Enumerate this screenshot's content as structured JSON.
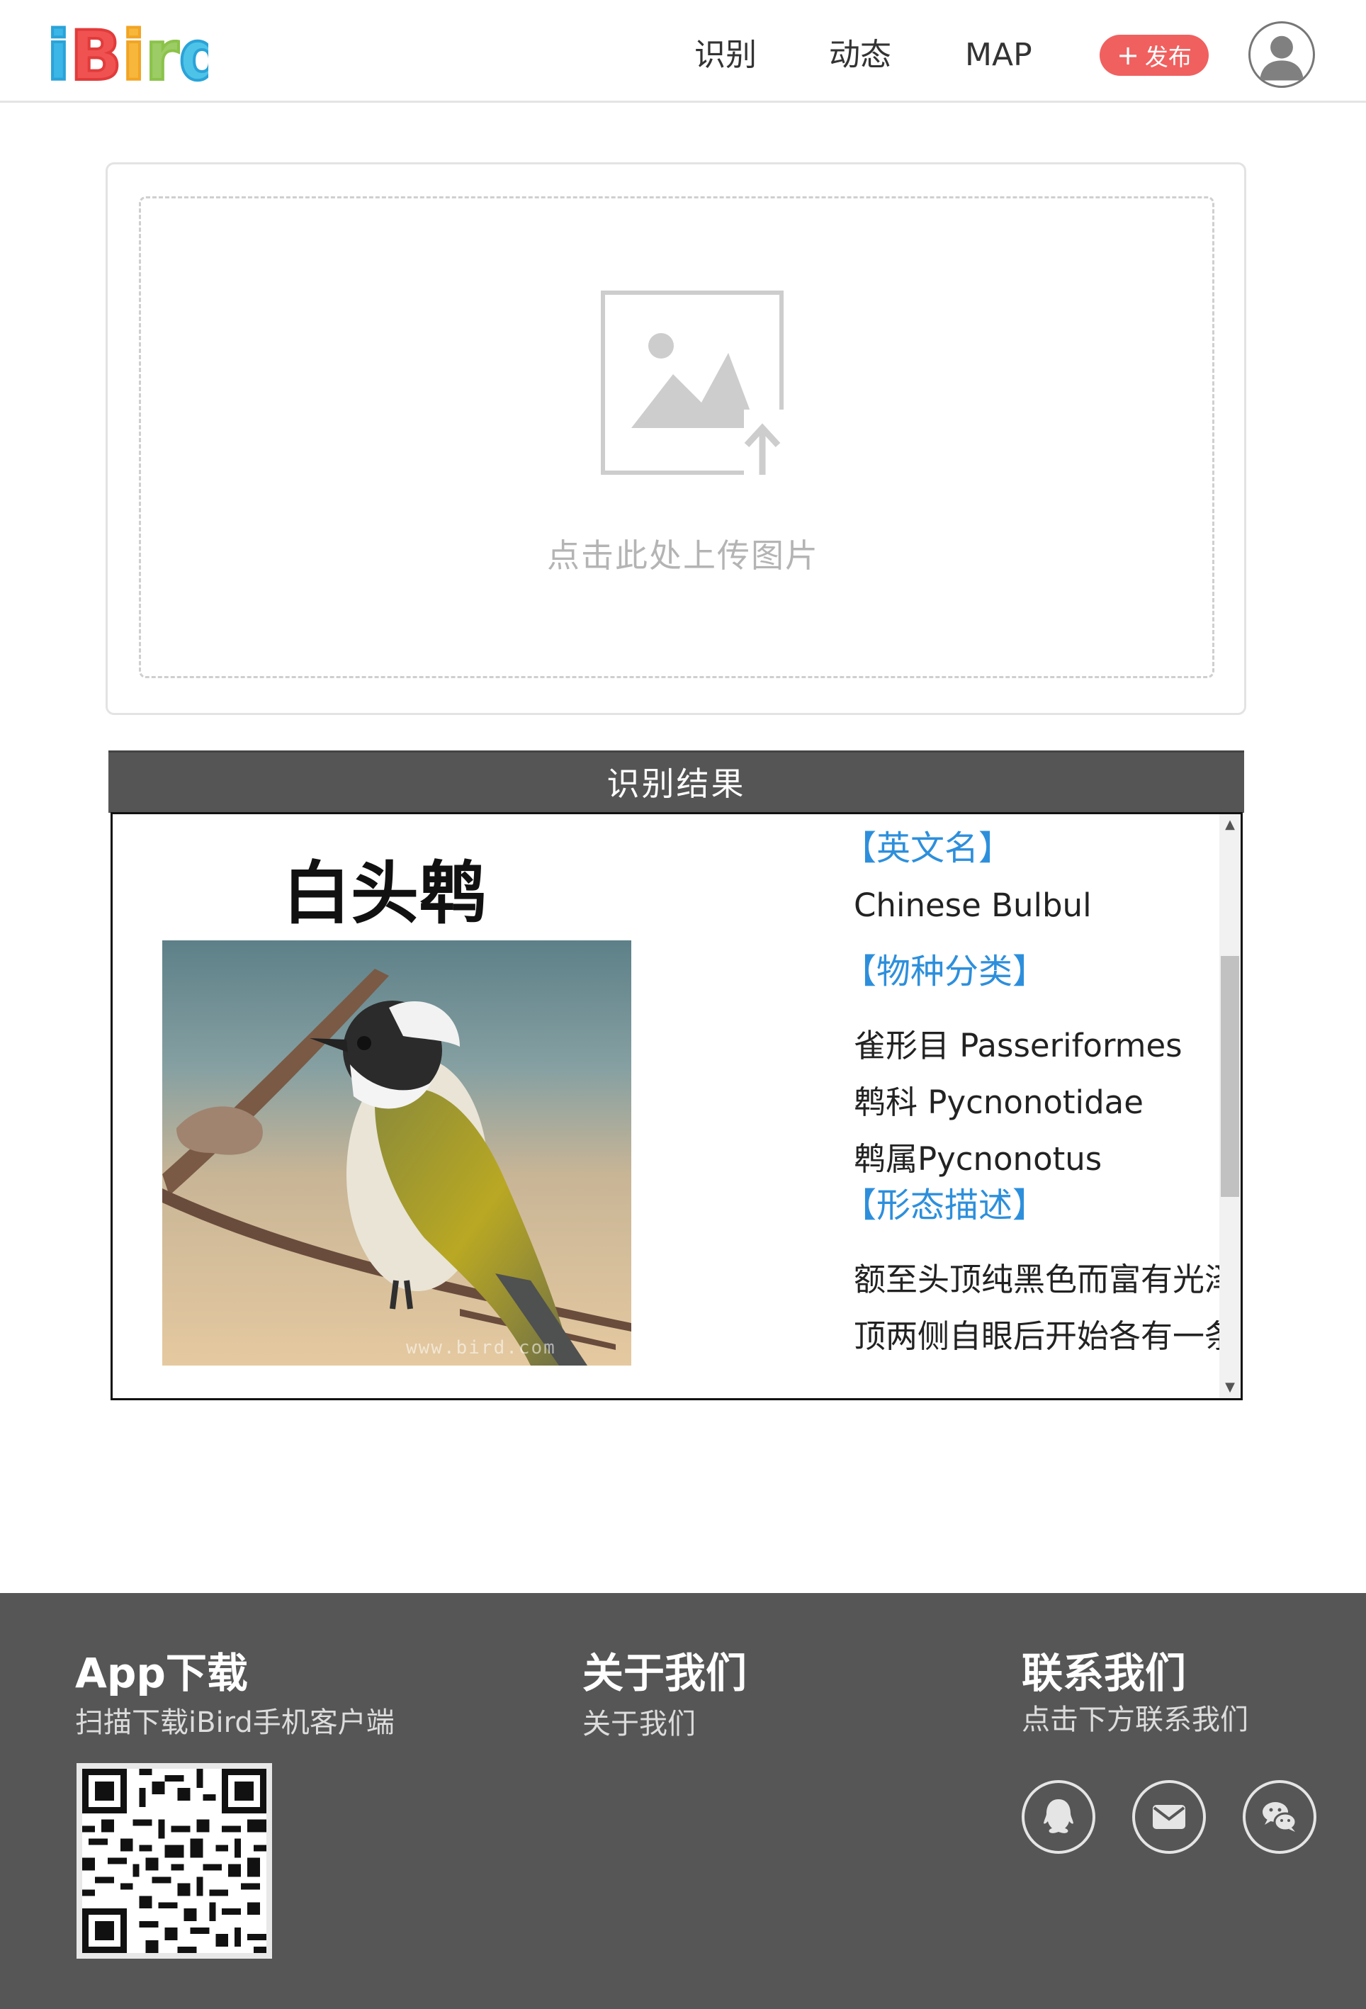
{
  "header": {
    "logo_text": "iBird",
    "nav": [
      {
        "label": "识别"
      },
      {
        "label": "动态"
      },
      {
        "label": "MAP"
      }
    ],
    "publish_plus": "+",
    "publish_label": "发布",
    "avatar_icon": "user-icon"
  },
  "upload": {
    "icon": "image-upload-icon",
    "hint": "点击此处上传图片"
  },
  "result": {
    "title": "识别结果",
    "species_name": "白头鹎",
    "photo_watermark": "www.bird.com",
    "sections": {
      "english_name_title": "【英文名】",
      "english_name": "Chinese Bulbul",
      "taxonomy_title": "【物种分类】",
      "order": "雀形目 Passeriformes",
      "family": "鹎科 Pycnonotidae",
      "genus": "鹎属Pycnonotus",
      "description_title": "【形态描述】",
      "description_line1": "额至头顶纯黑色而富有光泽，头",
      "description_line2": "顶两侧自眼后开始各有一条白纹"
    },
    "scrollbar": {
      "position_fraction": 0.4
    }
  },
  "footer": {
    "app": {
      "title": "App下载",
      "subtitle": "扫描下载iBird手机客户端",
      "qr_icon": "qr-code-icon"
    },
    "about": {
      "title": "关于我们",
      "link": "关于我们"
    },
    "contact": {
      "title": "联系我们",
      "subtitle": "点击下方联系我们",
      "icons": [
        "qq-icon",
        "mail-icon",
        "wechat-icon"
      ]
    }
  },
  "colors": {
    "accent_blue": "#2d8fdc",
    "publish_red": "#f0605f",
    "result_header_bg": "#555555",
    "footer_bg": "#565656"
  }
}
